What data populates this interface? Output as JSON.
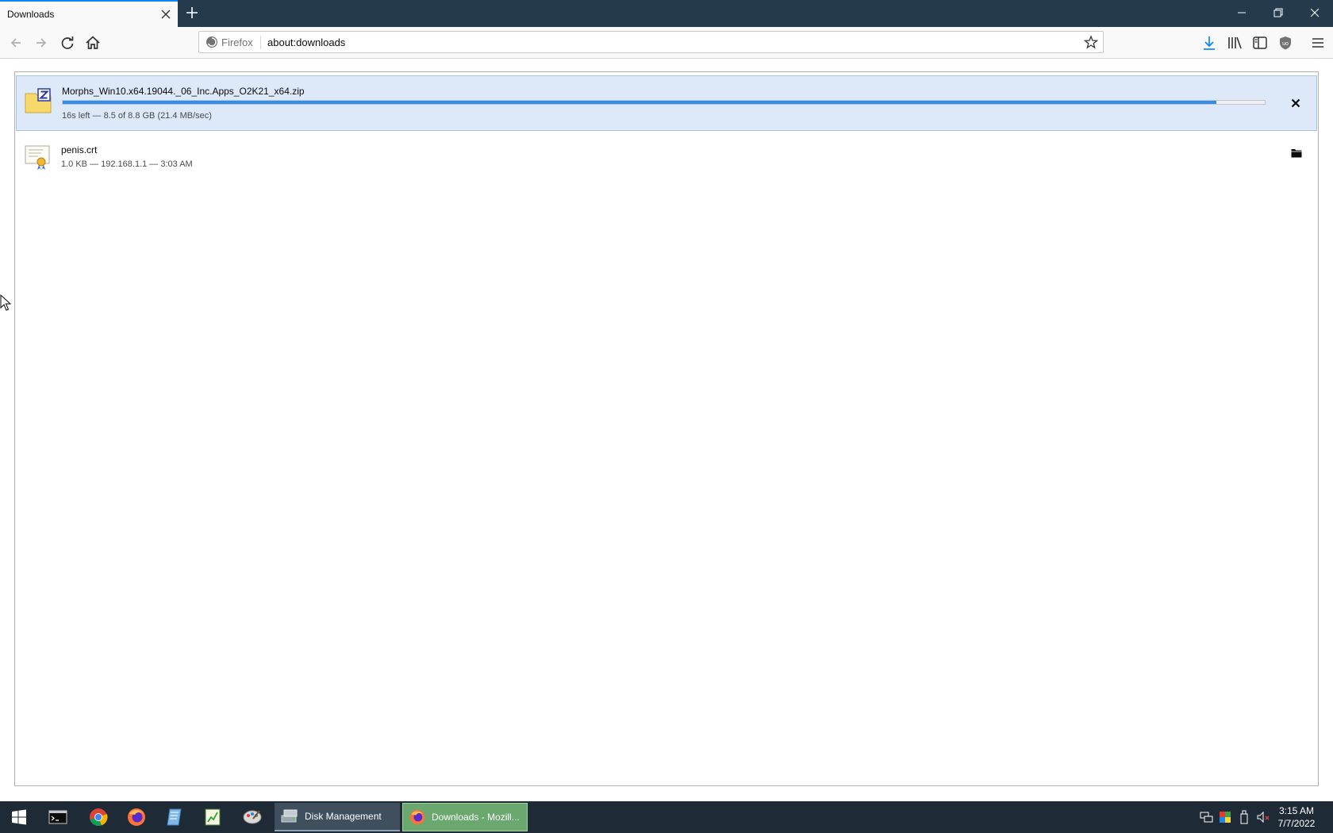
{
  "browser": {
    "tab": {
      "title": "Downloads"
    },
    "urlbar": {
      "identity_label": "Firefox",
      "url": "about:downloads"
    }
  },
  "downloads": [
    {
      "filename": "Morphs_Win10.x64.19044._06_Inc.Apps_O2K21_x64.zip",
      "status": "16s left — 8.5 of 8.8 GB (21.4 MB/sec)",
      "progress_percent": 96,
      "state": "in-progress",
      "icon": "zip-archive-icon",
      "action_icon": "cancel-icon"
    },
    {
      "filename": "penis.crt",
      "status": "1.0 KB — 192.168.1.1 — 3:03 AM",
      "state": "completed",
      "icon": "certificate-file-icon",
      "action_icon": "folder-icon"
    }
  ],
  "taskbar": {
    "apps": [
      {
        "label": "Disk Management"
      },
      {
        "label": "Downloads - Mozill..."
      }
    ],
    "clock": {
      "time": "3:15 AM",
      "date": "7/7/2022"
    }
  },
  "colors": {
    "accent": "#0a84ff",
    "progress": "#2f8ff0",
    "active_row": "#dde9f8",
    "tabstrip": "#253a4c",
    "taskbar": "#1e2a36"
  }
}
